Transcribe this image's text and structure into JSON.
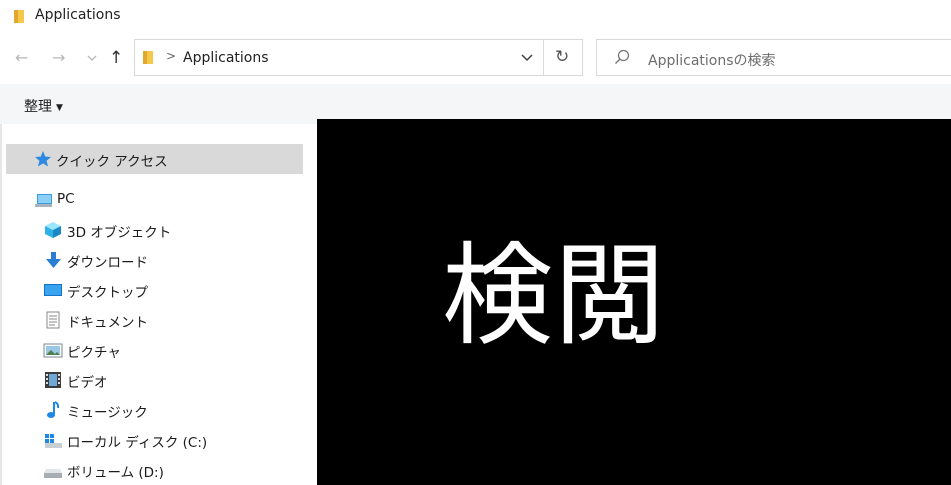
{
  "window": {
    "title": "Applications"
  },
  "address": {
    "path": "Applications",
    "separator": ">"
  },
  "search": {
    "placeholder": "Applicationsの検索"
  },
  "toolbar": {
    "organize_label": "整理",
    "organize_arrow": "▼"
  },
  "nav_buttons": {
    "back": "←",
    "forward": "→",
    "recent": "⌄",
    "up": "↑",
    "refresh": "↻"
  },
  "sidebar": {
    "items": [
      {
        "label": "クイック アクセス",
        "icon": "star-icon",
        "selected": true
      },
      {
        "label": "PC",
        "icon": "computer-icon"
      },
      {
        "label": "3D オブジェクト",
        "icon": "cube-3d-icon"
      },
      {
        "label": "ダウンロード",
        "icon": "download-arrow-icon"
      },
      {
        "label": "デスクトップ",
        "icon": "desktop-icon"
      },
      {
        "label": "ドキュメント",
        "icon": "document-icon"
      },
      {
        "label": "ピクチャ",
        "icon": "picture-icon"
      },
      {
        "label": "ビデオ",
        "icon": "video-film-icon"
      },
      {
        "label": "ミュージック",
        "icon": "music-note-icon"
      },
      {
        "label": "ローカル ディスク (C:)",
        "icon": "windows-drive-icon"
      },
      {
        "label": "ボリューム (D:)",
        "icon": "drive-icon"
      }
    ]
  },
  "preview": {
    "text": "検閲"
  },
  "colors": {
    "selected_bg": "#d9d9d9",
    "ribbon_bg": "#f5f6f7",
    "preview_bg": "#000000",
    "folder": "#f4c84a",
    "accent": "#1e88e5"
  }
}
